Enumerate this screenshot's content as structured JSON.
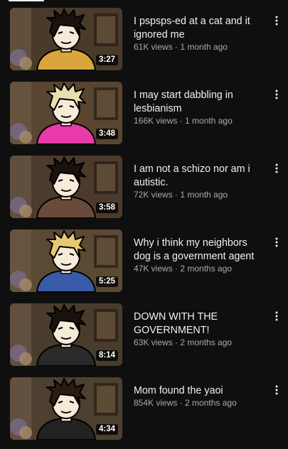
{
  "colors": {
    "background": "#0f0f0f",
    "text": "#f1f1f1",
    "secondary_text": "#aaaaaa"
  },
  "icons": {
    "more": "more-vert-icon"
  },
  "videos": [
    {
      "title": "I pspsps-ed at a cat and it ignored me",
      "views": "61K views",
      "age": "1 month ago",
      "stats": "61K views · 1 month ago",
      "duration": "3:27",
      "shirt_color": "#d8a63a",
      "hair_color": "#1a120c",
      "bg_color": "#4a3a2a"
    },
    {
      "title": "I may start dabbling in lesbianism",
      "views": "166K views",
      "age": "1 month ago",
      "stats": "166K views · 1 month ago",
      "duration": "3:48",
      "shirt_color": "#e83aa8",
      "hair_color": "#e8dfb0",
      "bg_color": "#5a4630"
    },
    {
      "title": "I am not a schizo nor am i autistic.",
      "views": "72K views",
      "age": "1 month ago",
      "stats": "72K views · 1 month ago",
      "duration": "3:58",
      "shirt_color": "#6a4a3a",
      "hair_color": "#1a120c",
      "bg_color": "#4c3a2c"
    },
    {
      "title": "Why i think my neighbors dog is a government agent",
      "views": "47K views",
      "age": "2 months ago",
      "stats": "47K views · 2 months ago",
      "duration": "5:25",
      "shirt_color": "#3a5aa8",
      "hair_color": "#e8c870",
      "bg_color": "#5a4a34"
    },
    {
      "title": "DOWN WITH THE GOVERNMENT!",
      "views": "63K views",
      "age": "2 months ago",
      "stats": "63K views · 2 months ago",
      "duration": "8:14",
      "shirt_color": "#2a2a2a",
      "hair_color": "#1a120c",
      "bg_color": "#4a3c2c"
    },
    {
      "title": "Mom found the yaoi",
      "views": "854K views",
      "age": "2 months ago",
      "stats": "854K views · 2 months ago",
      "duration": "4:34",
      "shirt_color": "#222222",
      "hair_color": "#2a1c10",
      "bg_color": "#4e4030"
    }
  ]
}
